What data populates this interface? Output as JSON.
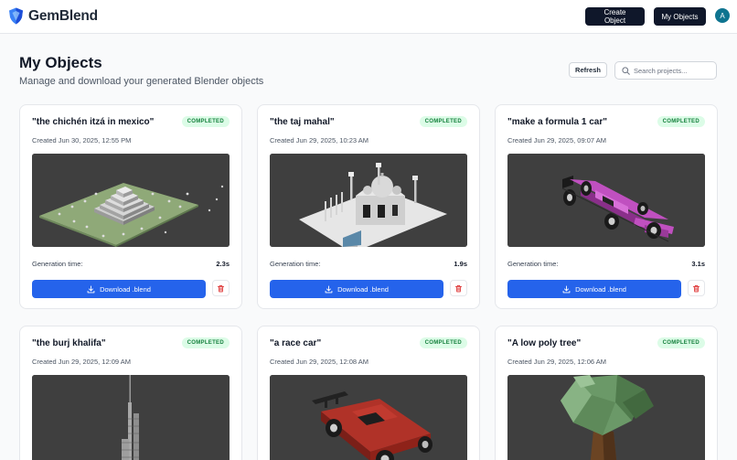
{
  "header": {
    "brand": "GemBlend",
    "create_label": "Create Object",
    "my_objects_label": "My Objects",
    "avatar_initial": "A"
  },
  "page": {
    "title": "My Objects",
    "subtitle": "Manage and download your generated Blender objects",
    "refresh_label": "Refresh",
    "search_placeholder": "Search projects..."
  },
  "objects": [
    {
      "title": "\"the chichén itzá in mexico\"",
      "status": "COMPLETED",
      "created": "Created Jun 30, 2025, 12:55 PM",
      "gen_label": "Generation time:",
      "gen_time": "2.3s",
      "download_label": "Download .blend",
      "thumbnail": "pyramid-render"
    },
    {
      "title": "\"the taj mahal\"",
      "status": "COMPLETED",
      "created": "Created Jun 29, 2025, 10:23 AM",
      "gen_label": "Generation time:",
      "gen_time": "1.9s",
      "download_label": "Download .blend",
      "thumbnail": "taj-mahal-render"
    },
    {
      "title": "\"make a formula 1 car\"",
      "status": "COMPLETED",
      "created": "Created Jun 29, 2025, 09:07 AM",
      "gen_label": "Generation time:",
      "gen_time": "3.1s",
      "download_label": "Download .blend",
      "thumbnail": "f1-car-render"
    },
    {
      "title": "\"the burj khalifa\"",
      "status": "COMPLETED",
      "created": "Created Jun 29, 2025, 12:09 AM",
      "thumbnail": "burj-khalifa-render"
    },
    {
      "title": "\"a race car\"",
      "status": "COMPLETED",
      "created": "Created Jun 29, 2025, 12:08 AM",
      "thumbnail": "race-car-render"
    },
    {
      "title": "\"A low poly tree\"",
      "status": "COMPLETED",
      "created": "Created Jun 29, 2025, 12:06 AM",
      "thumbnail": "tree-render"
    }
  ],
  "colors": {
    "primary_dark": "#0f172a",
    "download_blue": "#2563eb",
    "status_green_bg": "#dcfce7",
    "status_green_text": "#15803d",
    "render_bg": "#3f3f3f"
  }
}
